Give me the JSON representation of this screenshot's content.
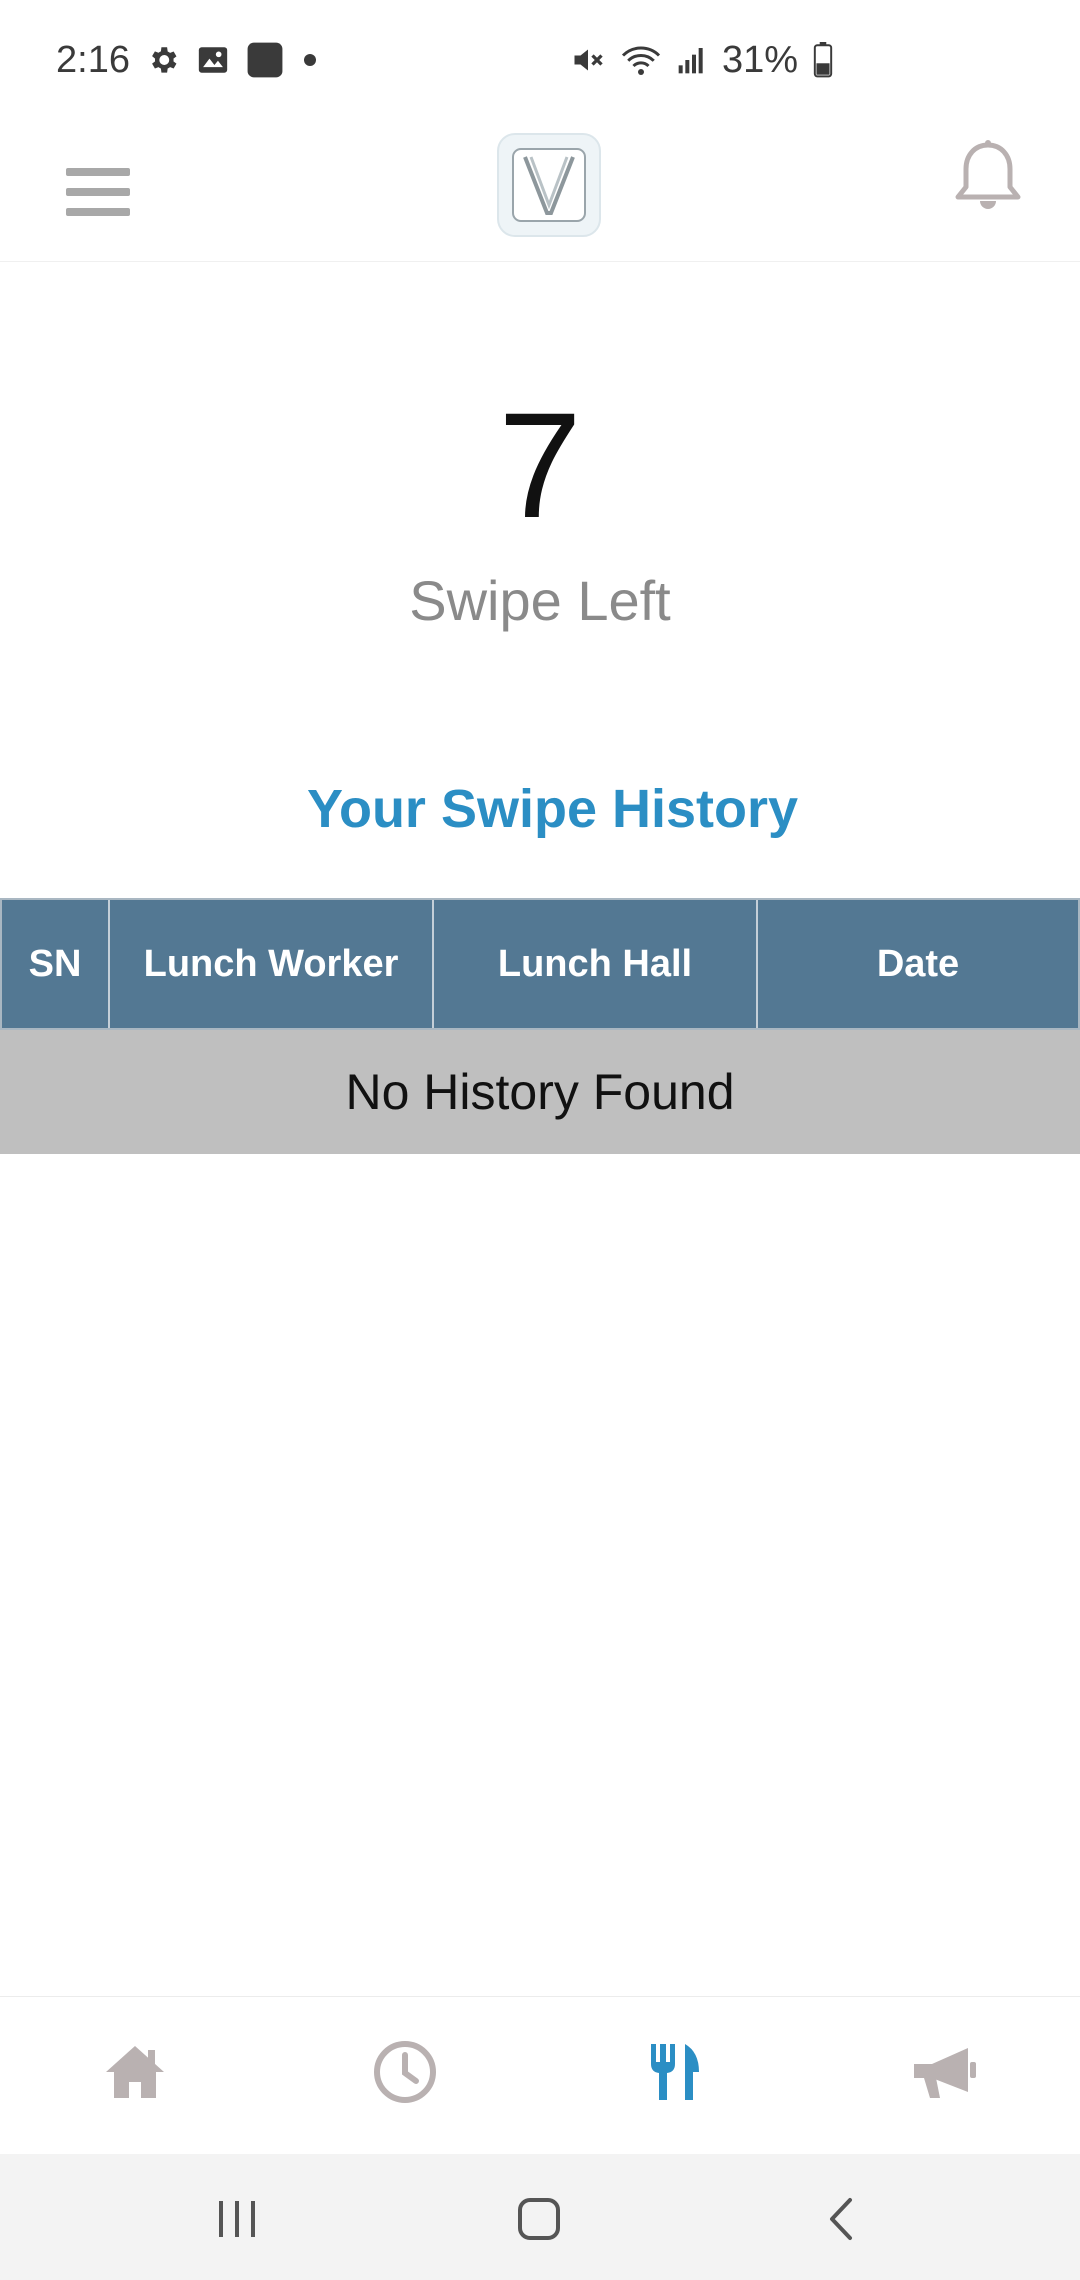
{
  "status_bar": {
    "time": "2:16",
    "battery_percent": "31%",
    "icons": [
      "gear-icon",
      "image-icon",
      "app-square-icon",
      "dot-icon",
      "mute-icon",
      "wifi-icon",
      "signal-icon",
      "battery-icon"
    ]
  },
  "header": {
    "menu_icon": "hamburger-menu-icon",
    "logo_icon": "v-logo-icon",
    "notification_icon": "bell-icon"
  },
  "swipes": {
    "count": "7",
    "label": "Swipe Left"
  },
  "history": {
    "title": "Your Swipe History",
    "columns": [
      "SN",
      "Lunch Worker",
      "Lunch Hall",
      "Date"
    ],
    "rows": [],
    "empty_message": "No History Found"
  },
  "bottom_nav": {
    "items": [
      {
        "icon": "home-icon",
        "active": false
      },
      {
        "icon": "clock-icon",
        "active": false
      },
      {
        "icon": "fork-knife-icon",
        "active": true
      },
      {
        "icon": "megaphone-icon",
        "active": false
      }
    ]
  },
  "colors": {
    "accent": "#2b8ec4",
    "table_header": "#537893",
    "empty_row": "#bfbfbf",
    "inactive_icon": "#b9b1b1"
  }
}
